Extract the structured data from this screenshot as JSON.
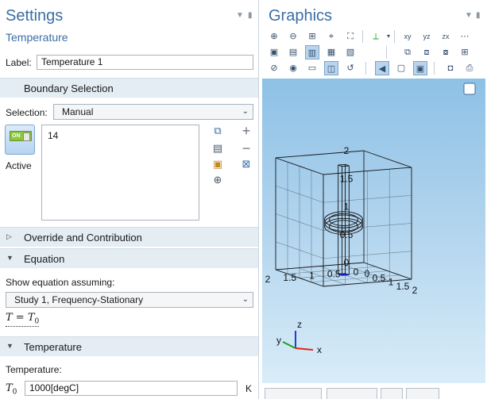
{
  "settings": {
    "title": "Settings",
    "subtitle": "Temperature",
    "label_caption": "Label:",
    "label_value": "Temperature 1",
    "boundary_section": "Boundary Selection",
    "selection_caption": "Selection:",
    "selection_value": "Manual",
    "active_label": "Active",
    "on_text": "ON",
    "selected_items": [
      "14"
    ],
    "override_section": "Override and Contribution",
    "equation_section": "Equation",
    "show_equation_caption": "Show equation assuming:",
    "study_value": "Study 1, Frequency-Stationary",
    "temperature_section": "Temperature",
    "temperature_caption": "Temperature:",
    "t0_symbol": "T",
    "t0_sub": "0",
    "t0_value": "1000[degC]",
    "t0_unit": "K",
    "equation_lhs": "T",
    "equation_rhs": "T",
    "equation_sub": "0"
  },
  "graphics": {
    "title": "Graphics",
    "axis_ticks": {
      "z": [
        "0",
        "0.5",
        "1",
        "1.5",
        "2"
      ],
      "x": [
        "0",
        "0.5",
        "1",
        "1.5",
        "2"
      ],
      "y": [
        "0",
        "0.5",
        "1",
        "1.5",
        "2"
      ]
    },
    "triad": {
      "x": "x",
      "y": "y",
      "z": "z"
    },
    "colors": {
      "triad_x": "#e0241b",
      "triad_y": "#1aa31a",
      "triad_z": "#1f3fd6",
      "selection": "#1c1ca8"
    }
  }
}
